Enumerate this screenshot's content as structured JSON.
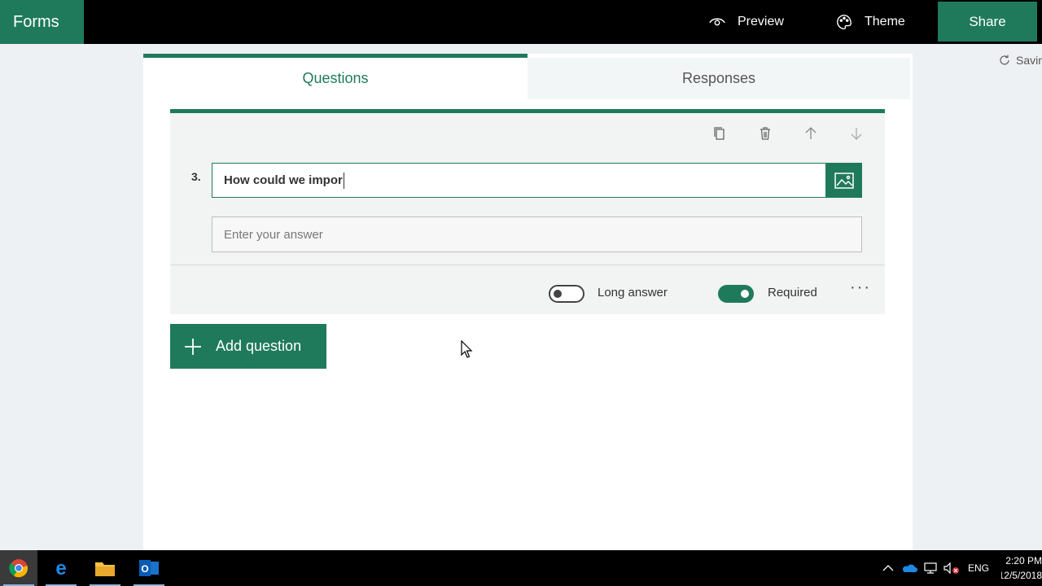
{
  "app": {
    "name": "Forms"
  },
  "header": {
    "preview_label": "Preview",
    "theme_label": "Theme",
    "share_label": "Share"
  },
  "status": {
    "saving_text": "Saving"
  },
  "tabs": [
    {
      "label": "Questions",
      "active": true
    },
    {
      "label": "Responses",
      "active": false
    }
  ],
  "question": {
    "number": "3.",
    "title_value": "How could we impor",
    "answer_placeholder": "Enter your answer",
    "long_answer_label": "Long answer",
    "long_answer_on": false,
    "required_label": "Required",
    "required_on": true,
    "more_label": "···",
    "toolbar_icons": [
      "copy-icon",
      "delete-icon",
      "move-up-icon",
      "move-down-icon"
    ]
  },
  "add_question_label": "Add question",
  "taskbar": {
    "apps": [
      "chrome-icon",
      "edge-icon",
      "file-explorer-icon",
      "outlook-icon"
    ],
    "language": "ENG",
    "time": "2:20 PM",
    "date": "12/5/2018"
  },
  "colors": {
    "accent": "#1f7a5c",
    "topbar": "#000000",
    "background": "#eef1f3"
  }
}
